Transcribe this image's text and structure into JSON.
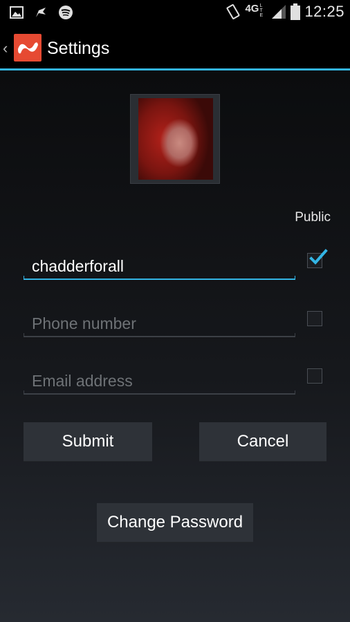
{
  "status_bar": {
    "time": "12:25",
    "network": "4G",
    "left_icons": [
      "gallery-icon",
      "notification-flag-icon",
      "spotify-icon"
    ],
    "right_icons": [
      "rotation-icon",
      "lte-icon",
      "signal-icon",
      "battery-icon"
    ]
  },
  "action_bar": {
    "title": "Settings",
    "accent_color": "#33b5e5",
    "logo_color": "#e64a32"
  },
  "profile": {
    "public_label": "Public"
  },
  "form": {
    "username": {
      "value": "chadderforall",
      "public": true
    },
    "phone": {
      "value": "",
      "placeholder": "Phone number",
      "public": false
    },
    "email": {
      "value": "",
      "placeholder": "Email address",
      "public": false
    }
  },
  "buttons": {
    "submit": "Submit",
    "cancel": "Cancel",
    "change_password": "Change Password"
  }
}
